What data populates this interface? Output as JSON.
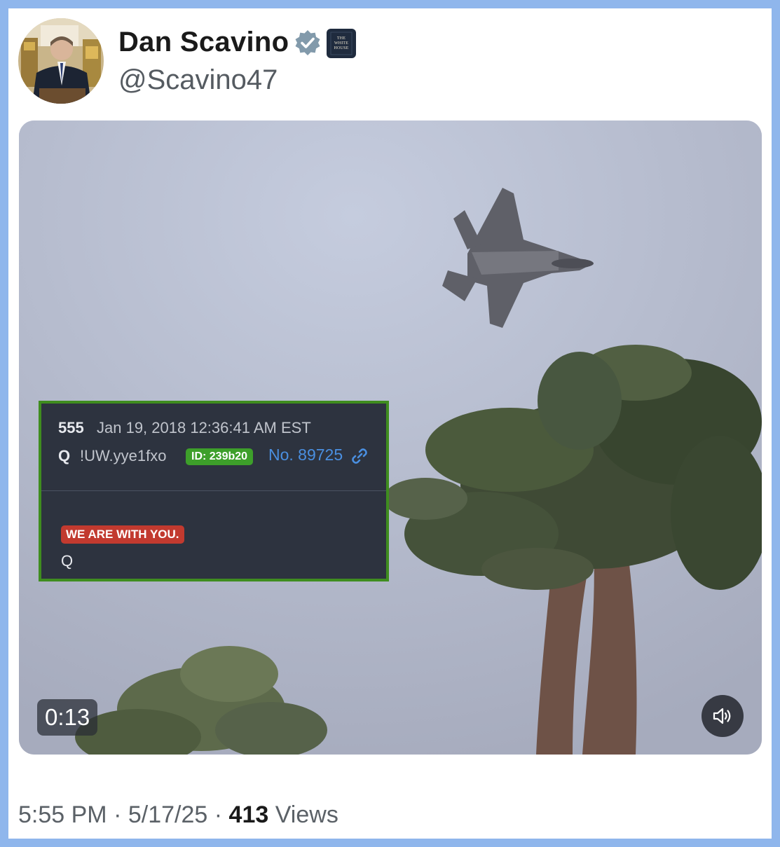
{
  "post": {
    "display_name": "Dan Scavino",
    "handle": "@Scavino47",
    "verified_icon": "verified-badge-icon",
    "affiliation_badge": {
      "icon": "white-house-badge-icon",
      "lines": [
        "THE",
        "WHITE",
        "HOUSE"
      ],
      "bg": "#1f2b3e"
    },
    "time": "5:55 PM",
    "separator": "·",
    "date": "5/17/25",
    "views_count": "413",
    "views_label": "Views"
  },
  "media": {
    "type": "video",
    "duration": "0:13",
    "mute_icon": "speaker-icon",
    "embedded_post": {
      "number": "555",
      "date": "Jan 19, 2018 12:36:41 AM EST",
      "name": "Q",
      "tripcode": "!UW.yye1fxo",
      "id_badge": "ID: 239b20",
      "post_no": "No. 89725",
      "link_icon": "link-icon",
      "highlight": "WE ARE WITH YOU.",
      "signature": "Q",
      "border_color": "#3f8d1f",
      "highlight_color": "#c23a2f",
      "id_color": "#3d9f2a"
    }
  },
  "colors": {
    "page_border": "#8fb6ec",
    "card_bg": "#ffffff",
    "verified": "#829aab"
  }
}
